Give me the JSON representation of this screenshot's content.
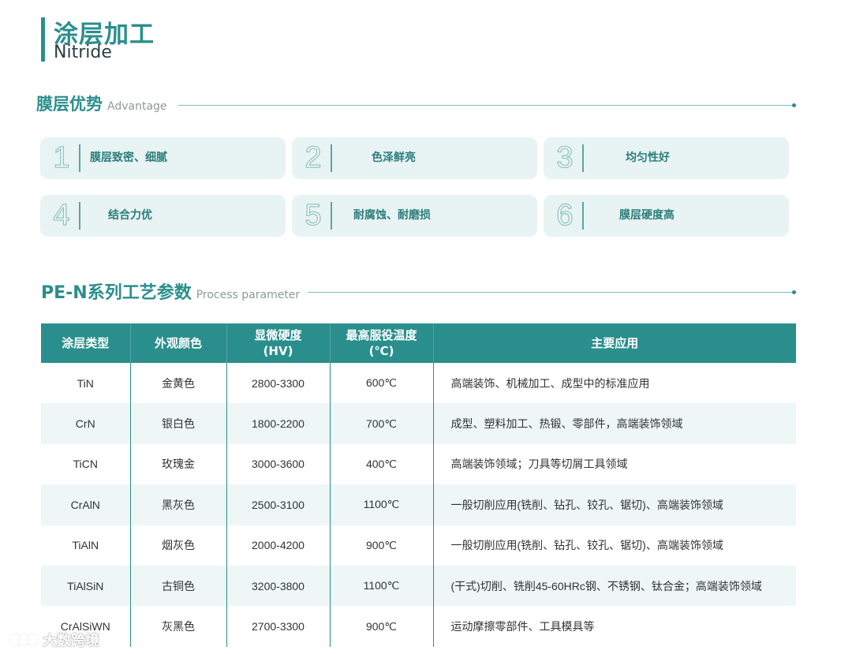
{
  "header": {
    "title_cn": "涂层加工",
    "title_en": "Nitride"
  },
  "advantage": {
    "title_cn": "膜层优势",
    "title_en": "Advantage",
    "items": [
      {
        "num": "1",
        "text": "膜层致密、细腻"
      },
      {
        "num": "2",
        "text": "色泽鲜亮"
      },
      {
        "num": "3",
        "text": "均匀性好"
      },
      {
        "num": "4",
        "text": "结合力优"
      },
      {
        "num": "5",
        "text": "耐腐蚀、耐磨损"
      },
      {
        "num": "6",
        "text": "膜层硬度高"
      }
    ]
  },
  "process": {
    "title_cn": "PE-N系列工艺参数",
    "title_en": "Process parameter",
    "columns": {
      "type": "涂层类型",
      "color": "外观颜色",
      "hardness_1": "显微硬度",
      "hardness_2": "(HV)",
      "temp_1": "最高服役温度",
      "temp_2": "(℃)",
      "application": "主要应用"
    },
    "rows": [
      {
        "type": "TiN",
        "color": "金黄色",
        "hardness": "2800-3300",
        "temp": "600℃",
        "application": "高端装饰、机械加工、成型中的标准应用"
      },
      {
        "type": "CrN",
        "color": "银白色",
        "hardness": "1800-2200",
        "temp": "700℃",
        "application": "成型、塑料加工、热锻、零部件，高端装饰领域"
      },
      {
        "type": "TiCN",
        "color": "玫瑰金",
        "hardness": "3000-3600",
        "temp": "400℃",
        "application": "高端装饰领域；刀具等切屑工具领域"
      },
      {
        "type": "CrAlN",
        "color": "黑灰色",
        "hardness": "2500-3100",
        "temp": "1100℃",
        "application": "一般切削应用(铣削、钻孔、铰孔、锯切)、高端装饰领域"
      },
      {
        "type": "TiAlN",
        "color": "烟灰色",
        "hardness": "2000-4200",
        "temp": "900℃",
        "application": "一般切削应用(铣削、钻孔、铰孔、锯切)、高端装饰领域"
      },
      {
        "type": "TiAlSiN",
        "color": "古铜色",
        "hardness": "3200-3800",
        "temp": "1100℃",
        "application": "(干式)切削、铣削45-60HRc钢、不锈钢、钛合金；高端装饰领域"
      },
      {
        "type": "CrAlSiWN",
        "color": "灰黑色",
        "hardness": "2700-3300",
        "temp": "900℃",
        "application": "运动摩擦零部件、工具模具等"
      }
    ]
  },
  "watermark": {
    "text": "大数跨境"
  },
  "colors": {
    "accent": "#2a8f8c",
    "card_bg": "#e8f3f3",
    "row_alt": "#eef6f6"
  }
}
